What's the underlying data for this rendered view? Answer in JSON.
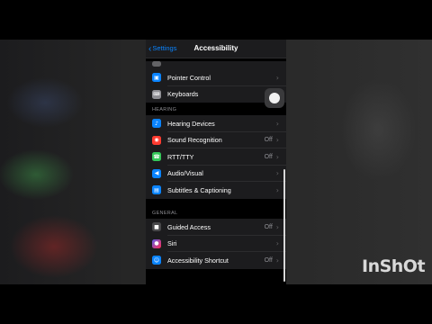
{
  "nav": {
    "back_label": "Settings",
    "title": "Accessibility"
  },
  "top_group": [
    {
      "label": "Pointer Control",
      "icon": "pointer-icon",
      "icon_color": "#0a84ff",
      "value": ""
    },
    {
      "label": "Keyboards",
      "icon": "keyboard-icon",
      "icon_color": "#8e8e93",
      "value": ""
    }
  ],
  "hearing": {
    "header": "HEARING",
    "items": [
      {
        "label": "Hearing Devices",
        "icon": "ear-icon",
        "icon_color": "#0a84ff",
        "value": ""
      },
      {
        "label": "Sound Recognition",
        "icon": "waveform-icon",
        "icon_color": "#ff3b30",
        "value": "Off"
      },
      {
        "label": "RTT/TTY",
        "icon": "rtt-icon",
        "icon_color": "#34c759",
        "value": "Off"
      },
      {
        "label": "Audio/Visual",
        "icon": "speaker-icon",
        "icon_color": "#0a84ff",
        "value": ""
      },
      {
        "label": "Subtitles & Captioning",
        "icon": "captions-icon",
        "icon_color": "#0a84ff",
        "value": ""
      }
    ]
  },
  "general": {
    "header": "GENERAL",
    "items": [
      {
        "label": "Guided Access",
        "icon": "lock-icon",
        "icon_color": "#48484a",
        "value": "Off"
      },
      {
        "label": "Siri",
        "icon": "siri-icon",
        "icon_color": "#5e5ce6",
        "value": ""
      },
      {
        "label": "Accessibility Shortcut",
        "icon": "accessibility-icon",
        "icon_color": "#0a84ff",
        "value": "Off"
      }
    ]
  },
  "watermark": "InShOt"
}
